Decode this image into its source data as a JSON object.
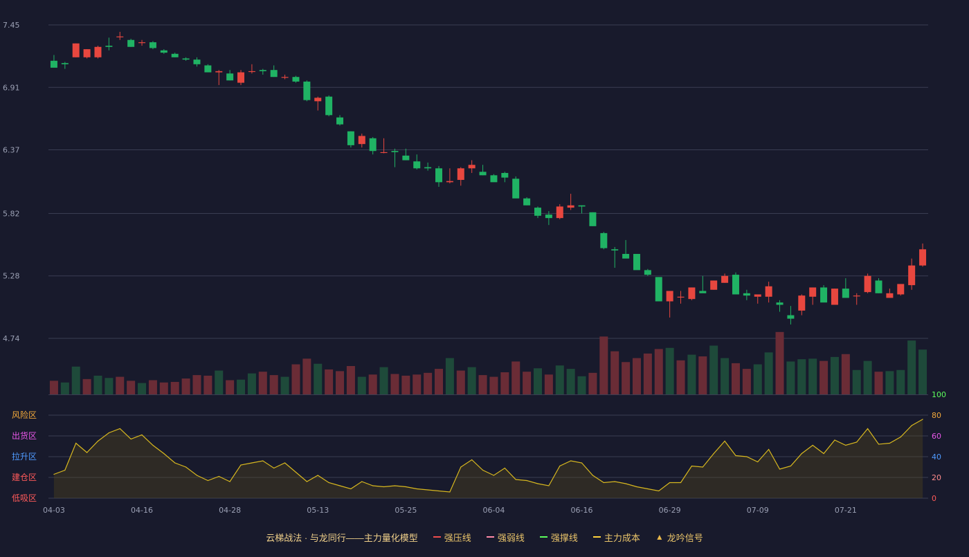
{
  "legend": {
    "title": "云梯战法 · 与龙同行——主力量化模型",
    "items": [
      {
        "label": "强压线",
        "color": "#ef4d4d",
        "style": "solid"
      },
      {
        "label": "强弱线",
        "color": "#ff8aa8",
        "style": "dashed"
      },
      {
        "label": "强撑线",
        "color": "#5cff5c",
        "style": "solid"
      },
      {
        "label": "主力成本",
        "color": "#ffd23c",
        "style": "dashed"
      },
      {
        "label": "龙吟信号",
        "color": "#e9b84a",
        "style": "triangle",
        "icon": "triangle-up-icon"
      }
    ]
  },
  "colors": {
    "background": "#181a2c",
    "up": "#e8473f",
    "down": "#20b364",
    "grid": "#3a3d52",
    "tick": "#9ba0b4",
    "osc_line": "#d8b81f"
  },
  "chart_data": [
    {
      "type": "candlestick",
      "y_ticks": [
        "7.45",
        "6.91",
        "6.37",
        "5.82",
        "5.28",
        "4.74"
      ],
      "ylim": [
        4.74,
        7.45
      ],
      "x_tick_labels": [
        "04-03",
        "04-16",
        "04-28",
        "05-13",
        "05-25",
        "06-04",
        "06-16",
        "06-29",
        "07-09",
        "07-21"
      ],
      "x_tick_indices": [
        0,
        8,
        16,
        24,
        32,
        40,
        48,
        56,
        64,
        72
      ],
      "ohlc": [
        [
          7.14,
          7.19,
          7.09,
          7.08
        ],
        [
          7.12,
          7.13,
          7.07,
          7.11
        ],
        [
          7.17,
          7.29,
          7.17,
          7.29
        ],
        [
          7.17,
          7.24,
          7.16,
          7.24
        ],
        [
          7.17,
          7.27,
          7.16,
          7.26
        ],
        [
          7.27,
          7.34,
          7.23,
          7.26
        ],
        [
          7.35,
          7.39,
          7.32,
          7.35
        ],
        [
          7.32,
          7.33,
          7.26,
          7.26
        ],
        [
          7.3,
          7.32,
          7.27,
          7.3
        ],
        [
          7.3,
          7.31,
          7.24,
          7.25
        ],
        [
          7.23,
          7.24,
          7.2,
          7.21
        ],
        [
          7.2,
          7.21,
          7.17,
          7.17
        ],
        [
          7.16,
          7.17,
          7.14,
          7.15
        ],
        [
          7.15,
          7.17,
          7.09,
          7.11
        ],
        [
          7.1,
          7.11,
          7.04,
          7.04
        ],
        [
          7.04,
          7.06,
          6.93,
          7.05
        ],
        [
          7.03,
          7.06,
          6.97,
          6.97
        ],
        [
          6.95,
          7.06,
          6.93,
          7.04
        ],
        [
          7.05,
          7.11,
          7.03,
          7.05
        ],
        [
          7.06,
          7.07,
          7.02,
          7.05
        ],
        [
          7.06,
          7.1,
          7.0,
          7.0
        ],
        [
          7.0,
          7.02,
          6.98,
          7.0
        ],
        [
          7.0,
          7.01,
          6.95,
          6.96
        ],
        [
          6.96,
          6.97,
          6.79,
          6.8
        ],
        [
          6.79,
          6.83,
          6.71,
          6.82
        ],
        [
          6.83,
          6.84,
          6.66,
          6.67
        ],
        [
          6.65,
          6.67,
          6.58,
          6.59
        ],
        [
          6.53,
          6.53,
          6.39,
          6.41
        ],
        [
          6.42,
          6.51,
          6.39,
          6.49
        ],
        [
          6.47,
          6.48,
          6.33,
          6.36
        ],
        [
          6.35,
          6.47,
          6.34,
          6.35
        ],
        [
          6.36,
          6.38,
          6.22,
          6.35
        ],
        [
          6.32,
          6.38,
          6.28,
          6.28
        ],
        [
          6.27,
          6.33,
          6.2,
          6.21
        ],
        [
          6.22,
          6.26,
          6.19,
          6.21
        ],
        [
          6.21,
          6.23,
          6.05,
          6.09
        ],
        [
          6.09,
          6.21,
          6.08,
          6.1
        ],
        [
          6.11,
          6.22,
          6.06,
          6.21
        ],
        [
          6.21,
          6.28,
          6.17,
          6.24
        ],
        [
          6.18,
          6.24,
          6.15,
          6.15
        ],
        [
          6.15,
          6.16,
          6.11,
          6.09
        ],
        [
          6.17,
          6.18,
          6.09,
          6.13
        ],
        [
          6.12,
          6.14,
          6.0,
          5.95
        ],
        [
          5.95,
          5.96,
          5.89,
          5.89
        ],
        [
          5.87,
          5.88,
          5.78,
          5.8
        ],
        [
          5.81,
          5.84,
          5.72,
          5.78
        ],
        [
          5.78,
          5.9,
          5.77,
          5.88
        ],
        [
          5.87,
          5.99,
          5.85,
          5.89
        ],
        [
          5.89,
          5.89,
          5.82,
          5.88
        ],
        [
          5.83,
          5.83,
          5.71,
          5.71
        ],
        [
          5.65,
          5.66,
          5.51,
          5.52
        ],
        [
          5.51,
          5.53,
          5.35,
          5.5
        ],
        [
          5.47,
          5.59,
          5.45,
          5.43
        ],
        [
          5.47,
          5.47,
          5.34,
          5.33
        ],
        [
          5.33,
          5.34,
          5.28,
          5.29
        ],
        [
          5.27,
          5.27,
          5.06,
          5.06
        ],
        [
          5.06,
          5.14,
          4.92,
          5.15
        ],
        [
          5.1,
          5.15,
          5.04,
          5.1
        ],
        [
          5.08,
          5.18,
          5.07,
          5.18
        ],
        [
          5.15,
          5.28,
          5.14,
          5.13
        ],
        [
          5.16,
          5.24,
          5.16,
          5.24
        ],
        [
          5.22,
          5.3,
          5.22,
          5.28
        ],
        [
          5.29,
          5.31,
          5.14,
          5.12
        ],
        [
          5.13,
          5.16,
          5.07,
          5.11
        ],
        [
          5.1,
          5.1,
          5.04,
          5.12
        ],
        [
          5.1,
          5.23,
          5.05,
          5.19
        ],
        [
          5.05,
          5.07,
          4.97,
          5.03
        ],
        [
          4.94,
          5.02,
          4.86,
          4.91
        ],
        [
          4.98,
          5.12,
          4.94,
          5.11
        ],
        [
          5.1,
          5.18,
          5.03,
          5.18
        ],
        [
          5.18,
          5.2,
          5.06,
          5.05
        ],
        [
          5.03,
          5.17,
          5.04,
          5.17
        ],
        [
          5.17,
          5.26,
          5.09,
          5.09
        ],
        [
          5.11,
          5.13,
          5.03,
          5.11
        ],
        [
          5.14,
          5.3,
          5.13,
          5.28
        ],
        [
          5.24,
          5.26,
          5.13,
          5.13
        ],
        [
          5.09,
          5.17,
          5.09,
          5.13
        ],
        [
          5.12,
          5.21,
          5.11,
          5.21
        ],
        [
          5.2,
          5.43,
          5.16,
          5.37
        ],
        [
          5.37,
          5.56,
          5.36,
          5.51
        ]
      ],
      "volume_max_label": "100",
      "volume": [
        [
          0.24,
          "up"
        ],
        [
          0.21,
          "down"
        ],
        [
          0.49,
          "down"
        ],
        [
          0.27,
          "up"
        ],
        [
          0.33,
          "down"
        ],
        [
          0.29,
          "down"
        ],
        [
          0.31,
          "up"
        ],
        [
          0.24,
          "up"
        ],
        [
          0.2,
          "down"
        ],
        [
          0.25,
          "up"
        ],
        [
          0.21,
          "up"
        ],
        [
          0.22,
          "up"
        ],
        [
          0.28,
          "up"
        ],
        [
          0.34,
          "up"
        ],
        [
          0.33,
          "up"
        ],
        [
          0.42,
          "down"
        ],
        [
          0.25,
          "up"
        ],
        [
          0.26,
          "down"
        ],
        [
          0.37,
          "down"
        ],
        [
          0.4,
          "up"
        ],
        [
          0.34,
          "up"
        ],
        [
          0.31,
          "down"
        ],
        [
          0.53,
          "up"
        ],
        [
          0.63,
          "up"
        ],
        [
          0.54,
          "down"
        ],
        [
          0.44,
          "up"
        ],
        [
          0.41,
          "up"
        ],
        [
          0.5,
          "up"
        ],
        [
          0.31,
          "down"
        ],
        [
          0.35,
          "up"
        ],
        [
          0.48,
          "down"
        ],
        [
          0.36,
          "up"
        ],
        [
          0.33,
          "up"
        ],
        [
          0.35,
          "up"
        ],
        [
          0.38,
          "up"
        ],
        [
          0.45,
          "up"
        ],
        [
          0.64,
          "down"
        ],
        [
          0.42,
          "up"
        ],
        [
          0.48,
          "down"
        ],
        [
          0.34,
          "up"
        ],
        [
          0.31,
          "up"
        ],
        [
          0.39,
          "up"
        ],
        [
          0.58,
          "up"
        ],
        [
          0.4,
          "up"
        ],
        [
          0.46,
          "down"
        ],
        [
          0.35,
          "up"
        ],
        [
          0.51,
          "down"
        ],
        [
          0.45,
          "down"
        ],
        [
          0.32,
          "down"
        ],
        [
          0.38,
          "up"
        ],
        [
          1.02,
          "up"
        ],
        [
          0.76,
          "up"
        ],
        [
          0.57,
          "up"
        ],
        [
          0.64,
          "up"
        ],
        [
          0.72,
          "up"
        ],
        [
          0.8,
          "up"
        ],
        [
          0.82,
          "down"
        ],
        [
          0.6,
          "up"
        ],
        [
          0.7,
          "down"
        ],
        [
          0.67,
          "up"
        ],
        [
          0.86,
          "down"
        ],
        [
          0.64,
          "down"
        ],
        [
          0.55,
          "up"
        ],
        [
          0.45,
          "up"
        ],
        [
          0.53,
          "down"
        ],
        [
          0.74,
          "down"
        ],
        [
          1.1,
          "up"
        ],
        [
          0.58,
          "down"
        ],
        [
          0.62,
          "down"
        ],
        [
          0.63,
          "down"
        ],
        [
          0.59,
          "up"
        ],
        [
          0.66,
          "down"
        ],
        [
          0.71,
          "up"
        ],
        [
          0.43,
          "down"
        ],
        [
          0.59,
          "down"
        ],
        [
          0.4,
          "up"
        ],
        [
          0.41,
          "down"
        ],
        [
          0.43,
          "down"
        ],
        [
          0.95,
          "down"
        ],
        [
          0.79,
          "down"
        ]
      ],
      "oscillator": {
        "y_ticks": [
          "0",
          "20",
          "40",
          "60",
          "80"
        ],
        "zone_labels": [
          {
            "text": "风险区",
            "color": "#f2a93b"
          },
          {
            "text": "出货区",
            "color": "#e857e8"
          },
          {
            "text": "拉升区",
            "color": "#4f9bff"
          },
          {
            "text": "建仓区",
            "color": "#ff5a5a"
          },
          {
            "text": "低吸区",
            "color": "#ff5a5a"
          }
        ],
        "tick_colors": [
          "#ff5a5a",
          "#ff8c8c",
          "#4f9bff",
          "#e857e8",
          "#f2a93b"
        ],
        "values": [
          23,
          27,
          53,
          44,
          55,
          63,
          67,
          57,
          61,
          51,
          43,
          34,
          30,
          22,
          17,
          21,
          16,
          32,
          34,
          36,
          29,
          34,
          25,
          16,
          22,
          15,
          12,
          9,
          16,
          12,
          11,
          12,
          11,
          9,
          8,
          7,
          6,
          30,
          37,
          27,
          22,
          29,
          18,
          17,
          14,
          12,
          31,
          36,
          34,
          22,
          15,
          16,
          14,
          11,
          9,
          7,
          15,
          15,
          31,
          30,
          43,
          55,
          41,
          40,
          35,
          47,
          28,
          31,
          43,
          51,
          43,
          56,
          51,
          54,
          67,
          52,
          53,
          59,
          70,
          76
        ]
      }
    }
  ]
}
